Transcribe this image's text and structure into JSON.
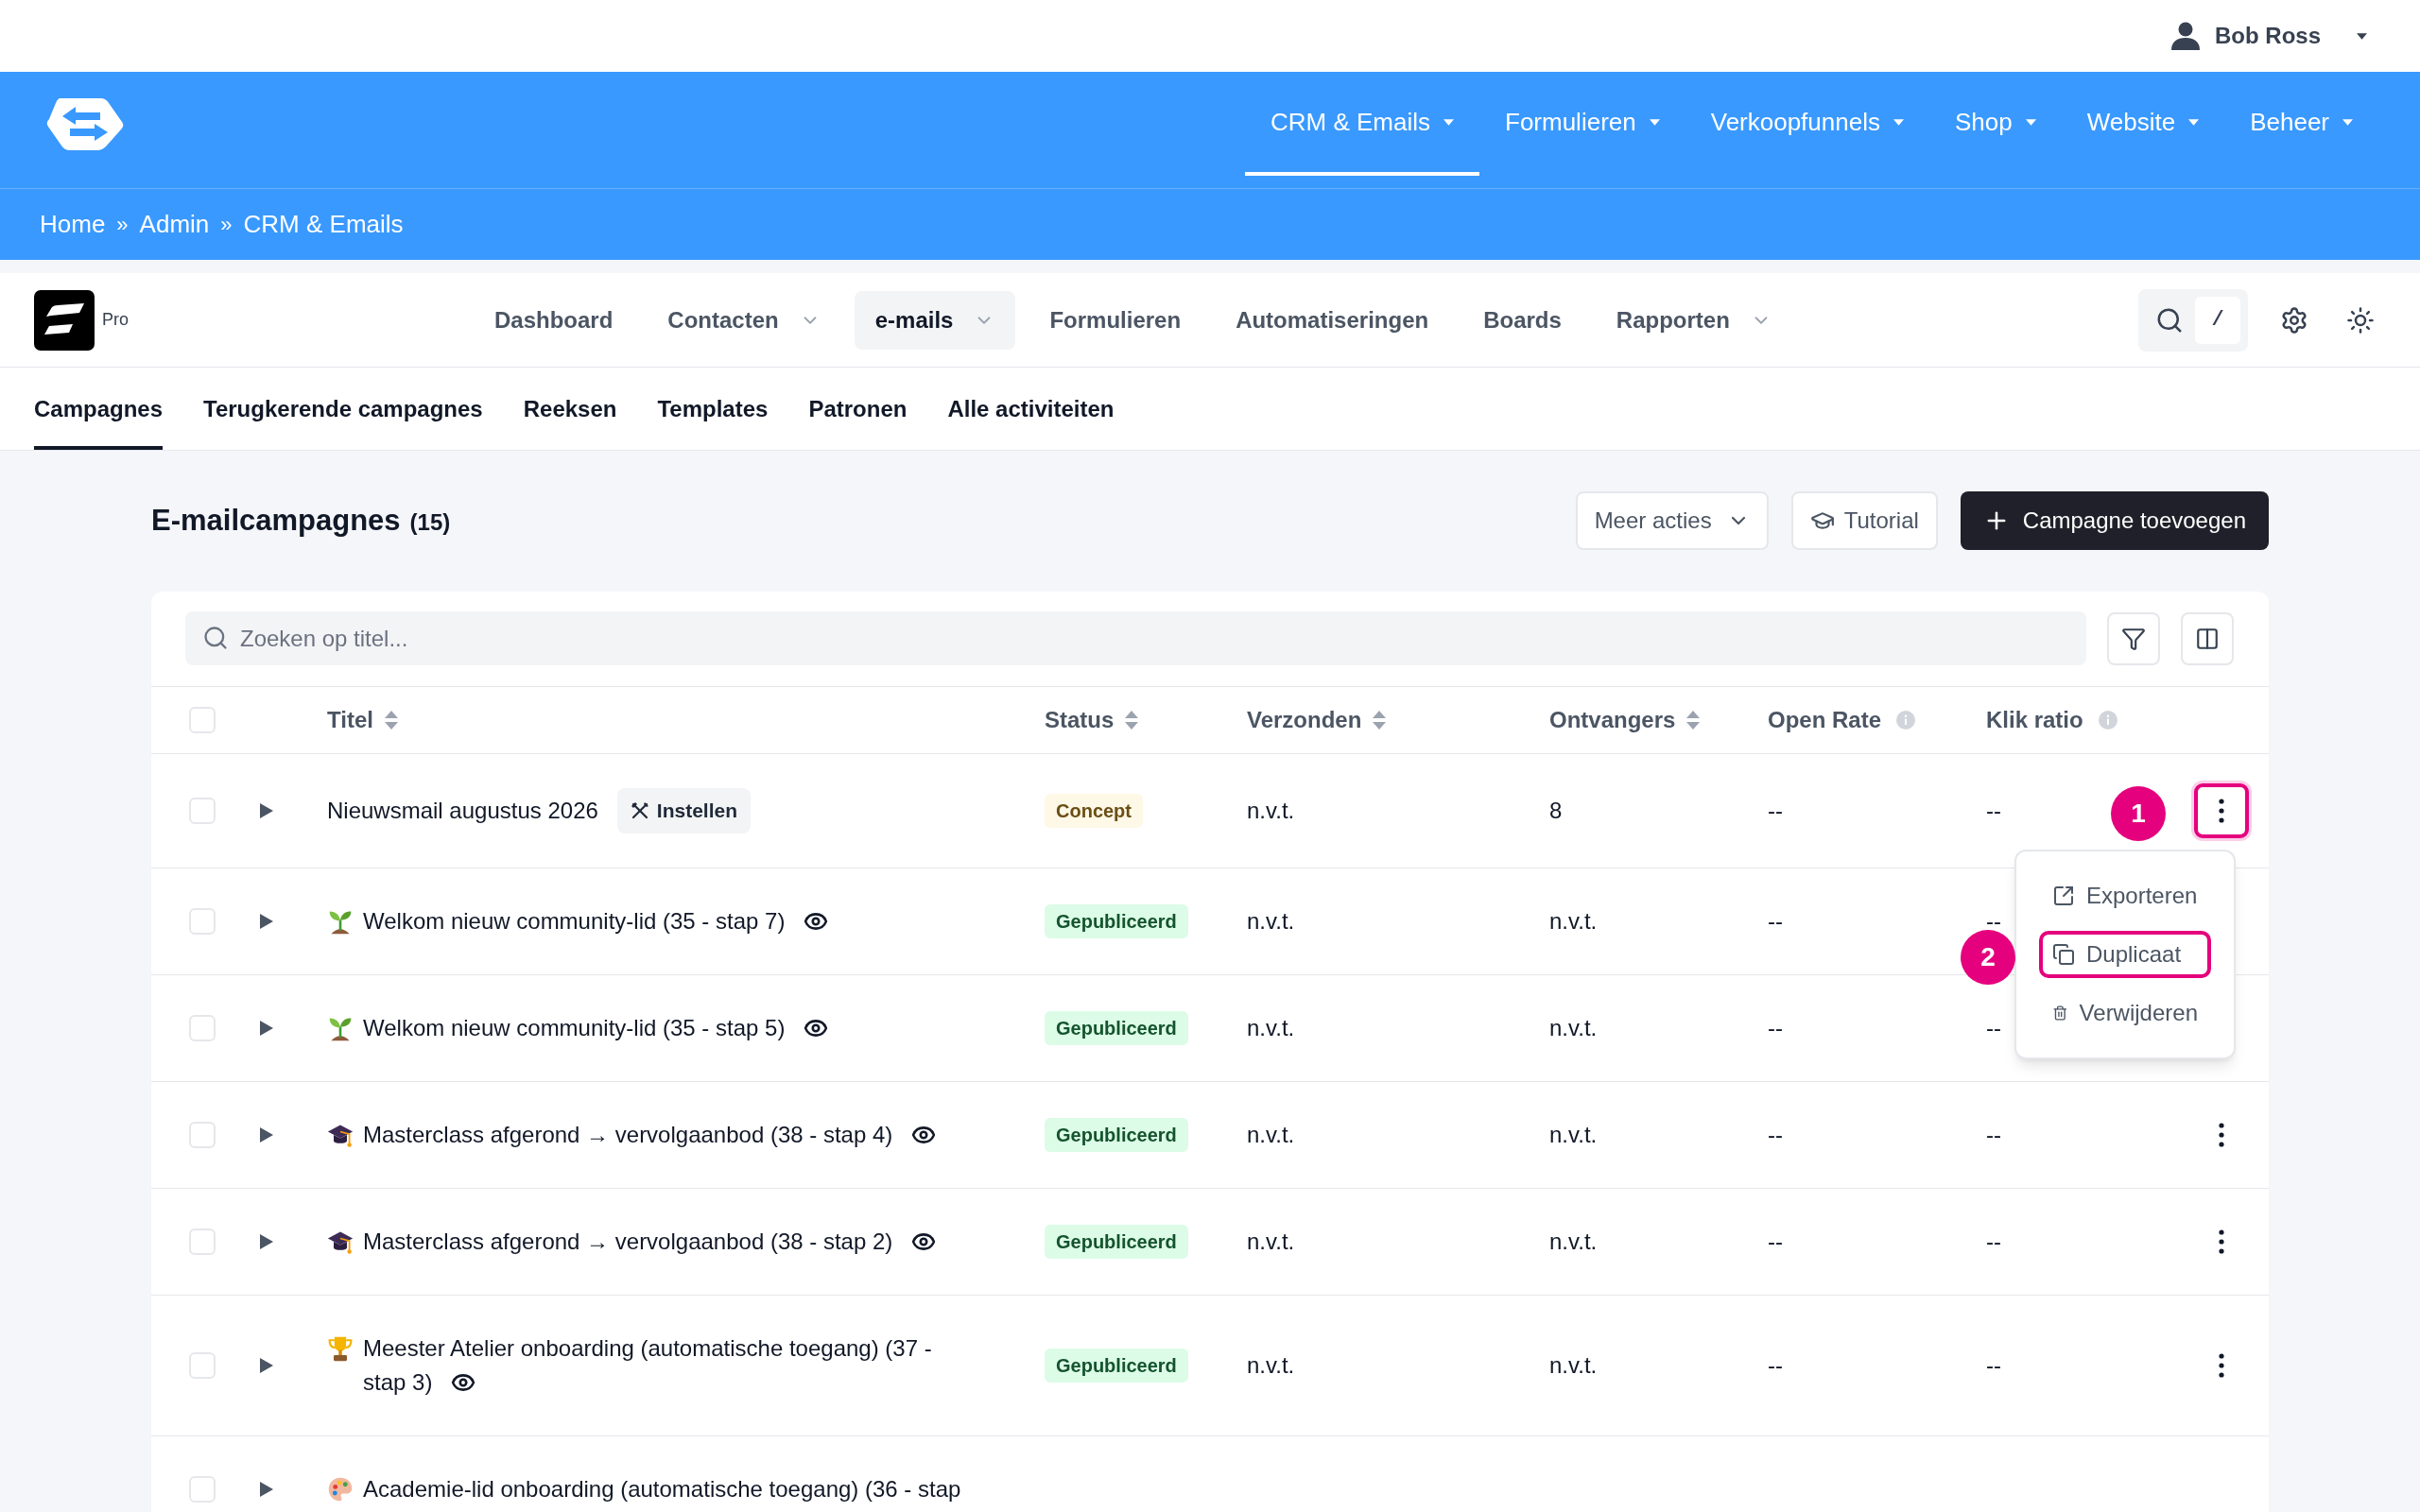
{
  "user_menu": {
    "name": "Bob Ross"
  },
  "main_nav": {
    "items": [
      {
        "label": "CRM & Emails",
        "selected": true
      },
      {
        "label": "Formulieren",
        "selected": false
      },
      {
        "label": "Verkoopfunnels",
        "selected": false
      },
      {
        "label": "Shop",
        "selected": false
      },
      {
        "label": "Website",
        "selected": false
      },
      {
        "label": "Beheer",
        "selected": false
      }
    ]
  },
  "breadcrumb": [
    {
      "label": "Home",
      "separator": "»"
    },
    {
      "label": "Admin",
      "separator": "»"
    },
    {
      "label": "CRM & Emails"
    }
  ],
  "app_nav": {
    "badge": "Pro",
    "items": [
      {
        "label": "Dashboard",
        "selected": false,
        "has_dropdown": false
      },
      {
        "label": "Contacten",
        "selected": false,
        "has_dropdown": true
      },
      {
        "label": "e-mails",
        "selected": true,
        "has_dropdown": true
      },
      {
        "label": "Formulieren",
        "selected": false,
        "has_dropdown": false
      },
      {
        "label": "Automatiseringen",
        "selected": false,
        "has_dropdown": false
      },
      {
        "label": "Boards",
        "selected": false,
        "has_dropdown": false
      },
      {
        "label": "Rapporten",
        "selected": false,
        "has_dropdown": true
      }
    ],
    "search_shortcut": "/"
  },
  "tabs": [
    {
      "label": "Campagnes",
      "selected": true
    },
    {
      "label": "Terugkerende campagnes",
      "selected": false
    },
    {
      "label": "Reeksen",
      "selected": false
    },
    {
      "label": "Templates",
      "selected": false
    },
    {
      "label": "Patronen",
      "selected": false
    },
    {
      "label": "Alle activiteiten",
      "selected": false
    }
  ],
  "page_header": {
    "title": "E-mailcampagnes",
    "count": "(15)",
    "buttons": [
      {
        "kind": "menu",
        "label": "Meer acties"
      },
      {
        "kind": "tutorial",
        "label": "Tutorial"
      },
      {
        "kind": "primary",
        "label": "Campagne toevoegen"
      }
    ]
  },
  "search": {
    "placeholder": "Zoeken op titel..."
  },
  "table": {
    "select_all": {
      "checked": false
    },
    "columns": [
      {
        "label": "Titel",
        "sortable": true,
        "info": false
      },
      {
        "label": "Status",
        "sortable": true,
        "info": false
      },
      {
        "label": "Verzonden",
        "sortable": true,
        "info": false
      },
      {
        "label": "Ontvangers",
        "sortable": true,
        "info": false
      },
      {
        "label": "Open Rate",
        "sortable": false,
        "info": true
      },
      {
        "label": "Klik ratio",
        "sortable": false,
        "info": true
      }
    ],
    "rows": [
      {
        "checked": false,
        "title": "Nieuwsmail augustus 2026",
        "setup_button": "Instellen",
        "preview": false,
        "status": {
          "kind": "draft",
          "label": "Concept"
        },
        "sent": "n.v.t.",
        "recipients": "8",
        "open_rate": "--",
        "click_rate": "--",
        "menu_button": {
          "highlighted": true
        }
      },
      {
        "checked": false,
        "title_icon": {
          "kind": "sprout"
        },
        "title": "Welkom nieuw community-lid (35 - stap 7)",
        "preview": true,
        "status": {
          "kind": "published",
          "label": "Gepubliceerd"
        },
        "sent": "n.v.t.",
        "recipients": "n.v.t.",
        "open_rate": "--",
        "click_rate": "--"
      },
      {
        "checked": false,
        "title_icon": {
          "kind": "sprout"
        },
        "title": "Welkom nieuw community-lid (35 - stap 5)",
        "preview": true,
        "status": {
          "kind": "published",
          "label": "Gepubliceerd"
        },
        "sent": "n.v.t.",
        "recipients": "n.v.t.",
        "open_rate": "--",
        "click_rate": "--"
      },
      {
        "checked": false,
        "title_icon": {
          "kind": "graduation-cap"
        },
        "title": "Masterclass afgerond → vervolgaanbod (38 - stap 4)",
        "preview": true,
        "status": {
          "kind": "published",
          "label": "Gepubliceerd"
        },
        "sent": "n.v.t.",
        "recipients": "n.v.t.",
        "open_rate": "--",
        "click_rate": "--",
        "menu_button": {
          "highlighted": false
        }
      },
      {
        "checked": false,
        "title_icon": {
          "kind": "graduation-cap"
        },
        "title": "Masterclass afgerond → vervolgaanbod (38 - stap 2)",
        "preview": true,
        "status": {
          "kind": "published",
          "label": "Gepubliceerd"
        },
        "sent": "n.v.t.",
        "recipients": "n.v.t.",
        "open_rate": "--",
        "click_rate": "--",
        "menu_button": {
          "highlighted": false
        }
      },
      {
        "checked": false,
        "title_icon": {
          "kind": "trophy"
        },
        "title": "Meester Atelier onboarding (automatische toegang) (37 - stap 3)",
        "preview": true,
        "status": {
          "kind": "published",
          "label": "Gepubliceerd"
        },
        "sent": "n.v.t.",
        "recipients": "n.v.t.",
        "open_rate": "--",
        "click_rate": "--",
        "menu_button": {
          "highlighted": false
        }
      },
      {
        "checked": false,
        "title_icon": {
          "kind": "palette"
        },
        "title": "Academie-lid onboarding (automatische toegang) (36 - stap"
      }
    ]
  },
  "row_menu": {
    "items": [
      {
        "kind": "export",
        "label": "Exporteren",
        "highlighted": false
      },
      {
        "kind": "duplicate",
        "label": "Duplicaat",
        "highlighted": true
      },
      {
        "kind": "delete",
        "label": "Verwijderen",
        "highlighted": false
      }
    ]
  },
  "annotations": [
    {
      "label": "1"
    },
    {
      "label": "2"
    }
  ]
}
